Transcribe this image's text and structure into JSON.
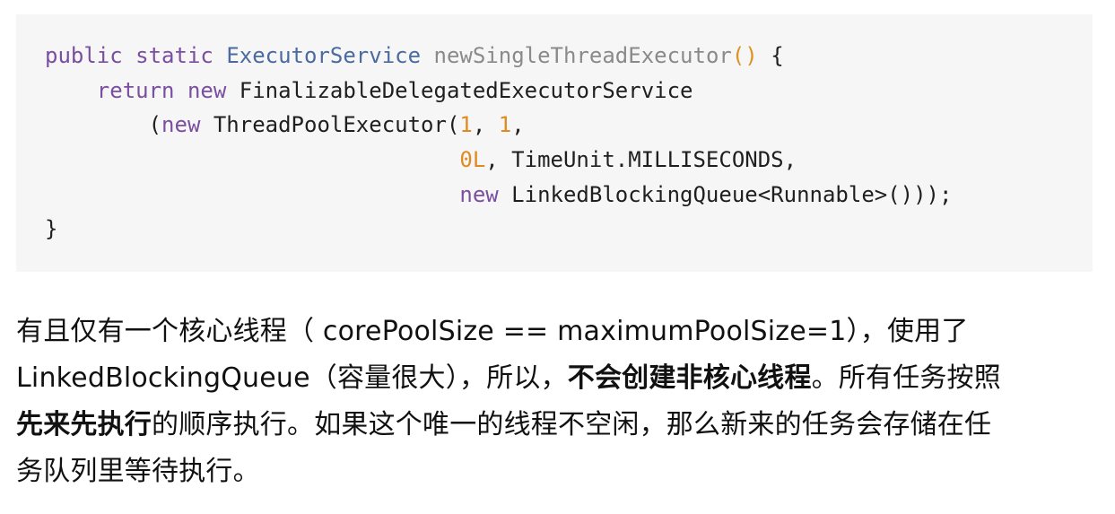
{
  "code": {
    "lines": [
      [
        {
          "t": "kw",
          "v": "public"
        },
        {
          "t": "plain",
          "v": " "
        },
        {
          "t": "kw",
          "v": "static"
        },
        {
          "t": "plain",
          "v": " "
        },
        {
          "t": "type",
          "v": "ExecutorService"
        },
        {
          "t": "plain",
          "v": " "
        },
        {
          "t": "fn",
          "v": "newSingleThreadExecutor"
        },
        {
          "t": "paren",
          "v": "()"
        },
        {
          "t": "plain",
          "v": " {"
        }
      ],
      [
        {
          "t": "plain",
          "v": "    "
        },
        {
          "t": "kw",
          "v": "return"
        },
        {
          "t": "plain",
          "v": " "
        },
        {
          "t": "kw",
          "v": "new"
        },
        {
          "t": "plain",
          "v": " FinalizableDelegatedExecutorService"
        }
      ],
      [
        {
          "t": "plain",
          "v": "        ("
        },
        {
          "t": "kw",
          "v": "new"
        },
        {
          "t": "plain",
          "v": " ThreadPoolExecutor("
        },
        {
          "t": "num",
          "v": "1"
        },
        {
          "t": "plain",
          "v": ", "
        },
        {
          "t": "num",
          "v": "1"
        },
        {
          "t": "plain",
          "v": ","
        }
      ],
      [
        {
          "t": "plain",
          "v": "                                "
        },
        {
          "t": "num",
          "v": "0L"
        },
        {
          "t": "plain",
          "v": ", TimeUnit.MILLISECONDS,"
        }
      ],
      [
        {
          "t": "plain",
          "v": "                                "
        },
        {
          "t": "kw",
          "v": "new"
        },
        {
          "t": "plain",
          "v": " LinkedBlockingQueue<Runnable>()));"
        }
      ],
      [
        {
          "t": "plain",
          "v": "}"
        }
      ]
    ]
  },
  "prose": {
    "line1": "有且仅有一个核心线程（ corePoolSize == maximumPoolSize=1），使用了",
    "line2_a": "LinkedBlockingQueue（容量很大），所以，",
    "line2_b": "不会创建非核心线程",
    "line2_c": "。所有任务按照",
    "line3_a": "先来先执行",
    "line3_b": "的顺序执行。如果这个唯一的线程不空闲，那么新来的任务会存储在任",
    "line4": "务队列里等待执行。"
  },
  "colors": {
    "keyword": "#7a4ea0",
    "type": "#4a6aa0",
    "method": "#8a8a8a",
    "number": "#e08a1f",
    "code_background": "#f6f6f6"
  }
}
